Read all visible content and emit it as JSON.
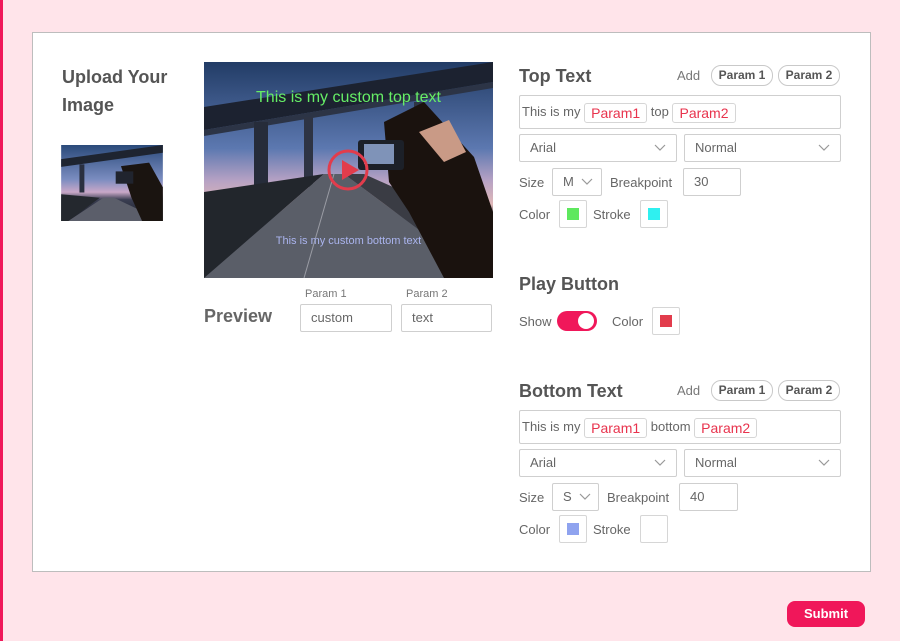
{
  "upload": {
    "title": "Upload Your Image"
  },
  "preview": {
    "label": "Preview",
    "top_text": "This is my custom top text",
    "bottom_text": "This is my custom bottom text",
    "param1_label": "Param 1",
    "param1_value": "custom",
    "param2_label": "Param 2",
    "param2_value": "text"
  },
  "top_text": {
    "title": "Top Text",
    "add_label": "Add",
    "param1_button": "Param 1",
    "param2_button": "Param 2",
    "text_prefix": "This is my",
    "token1": "Param1",
    "text_middle": "top",
    "token2": "Param2",
    "font": "Arial",
    "weight": "Normal",
    "size_label": "Size",
    "size_value": "M",
    "breakpoint_label": "Breakpoint",
    "breakpoint_value": "30",
    "color_label": "Color",
    "stroke_label": "Stroke",
    "color": "#5ee85e",
    "stroke": "#2ff0f0"
  },
  "play_button": {
    "title": "Play Button",
    "show_label": "Show",
    "show": true,
    "color_label": "Color",
    "color": "#e23c4c"
  },
  "bottom_text": {
    "title": "Bottom Text",
    "add_label": "Add",
    "param1_button": "Param 1",
    "param2_button": "Param 2",
    "text_prefix": "This is my",
    "token1": "Param1",
    "text_middle": "bottom",
    "token2": "Param2",
    "font": "Arial",
    "weight": "Normal",
    "size_label": "Size",
    "size_value": "S",
    "breakpoint_label": "Breakpoint",
    "breakpoint_value": "40",
    "color_label": "Color",
    "stroke_label": "Stroke",
    "color": "#8fa3ef",
    "stroke": "#ffffff"
  },
  "submit": {
    "label": "Submit"
  },
  "colors": {
    "accent": "#f0175a",
    "background": "#ffe4ea"
  }
}
